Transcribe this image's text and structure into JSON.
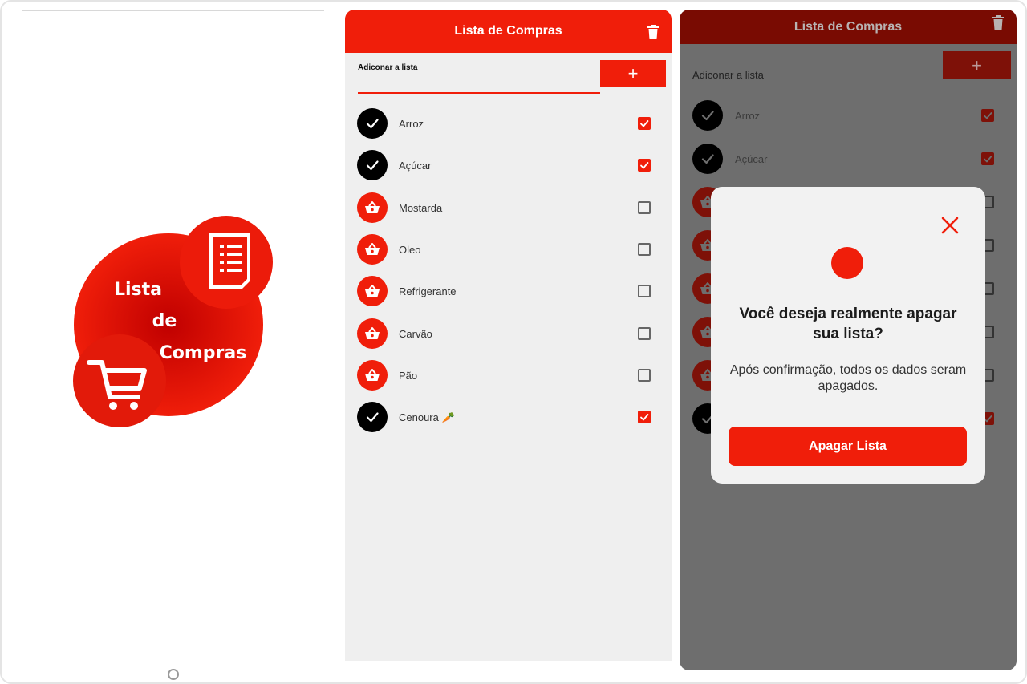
{
  "splash": {
    "logo_line1": "Lista",
    "logo_line2": "de",
    "logo_line3": "Compras"
  },
  "list_screen": {
    "title": "Lista de Compras",
    "add_label": "Adiconar a lista",
    "add_button": "+",
    "items": [
      {
        "label": "Arroz",
        "checked": true
      },
      {
        "label": "Açúcar",
        "checked": true
      },
      {
        "label": "Mostarda",
        "checked": false
      },
      {
        "label": "Oleo",
        "checked": false
      },
      {
        "label": "Refrigerante",
        "checked": false
      },
      {
        "label": "Carvão",
        "checked": false
      },
      {
        "label": "Pão",
        "checked": false
      },
      {
        "label": "Cenoura 🥕",
        "checked": true
      }
    ]
  },
  "dialog_screen": {
    "title": "Lista de Compras",
    "add_label": "Adiconar a lista",
    "add_button": "+",
    "visible_items": [
      {
        "label": "Arroz",
        "checked": true
      },
      {
        "label": "Açúcar",
        "checked": true
      }
    ],
    "dialog": {
      "title": "Você deseja realmente apagar sua lista?",
      "message": "Após confirmação, todos os dados seram apagados.",
      "confirm_button": "Apagar Lista"
    }
  },
  "colors": {
    "primary": "#f01e0a",
    "checked_avatar": "#000000",
    "background": "#efefef",
    "overlay": "#6e6e6e"
  },
  "icons": [
    "trash-icon",
    "check-icon",
    "basket-icon",
    "close-icon",
    "plus-icon",
    "cart-icon",
    "document-icon"
  ]
}
